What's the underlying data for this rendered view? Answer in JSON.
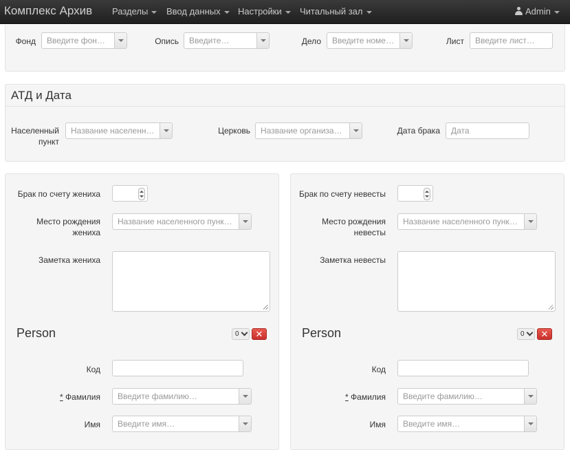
{
  "navbar": {
    "brand": "Комплекс Архив",
    "menu": [
      {
        "label": "Разделы"
      },
      {
        "label": "Ввод данных"
      },
      {
        "label": "Настройки"
      },
      {
        "label": "Читальный зал"
      }
    ],
    "user": "Admin"
  },
  "archive": {
    "fond_label": "Фонд",
    "fond_placeholder": "Введите фонд…",
    "opis_label": "Опись",
    "opis_placeholder": "Введите…",
    "delo_label": "Дело",
    "delo_placeholder": "Введите номер…",
    "list_label": "Лист",
    "list_placeholder": "Введите лист…"
  },
  "atd": {
    "title": "АТД и Дата",
    "settlement_label_1": "Населенный",
    "settlement_label_2": "пункт",
    "settlement_placeholder": "Название населенно…",
    "church_label": "Церковь",
    "church_placeholder": "Название организац…",
    "date_label": "Дата брака",
    "date_placeholder": "Дата"
  },
  "groom": {
    "marriage_count_label": "Брак по счету жениха",
    "birthplace_label_1": "Место рождения",
    "birthplace_label_2": "жениха",
    "birthplace_placeholder": "Название населенного пункта…",
    "note_label": "Заметка жениха",
    "person": {
      "title": "Person",
      "counter": "0",
      "delete": "✕",
      "code_label": "Код",
      "surname_star": "*",
      "surname_label": "Фамилия",
      "surname_placeholder": "Введите фамилию…",
      "name_label": "Имя",
      "name_placeholder": "Введите имя…"
    }
  },
  "bride": {
    "marriage_count_label": "Брак по счету невесты",
    "birthplace_label_1": "Место рождения",
    "birthplace_label_2": "невесты",
    "birthplace_placeholder": "Название населенного пункта…",
    "note_label": "Заметка невесты",
    "person": {
      "title": "Person",
      "counter": "0",
      "delete": "✕",
      "code_label": "Код",
      "surname_star": "*",
      "surname_label": "Фамилия",
      "surname_placeholder": "Введите фамилию…",
      "name_label": "Имя",
      "name_placeholder": "Введите имя…"
    }
  }
}
